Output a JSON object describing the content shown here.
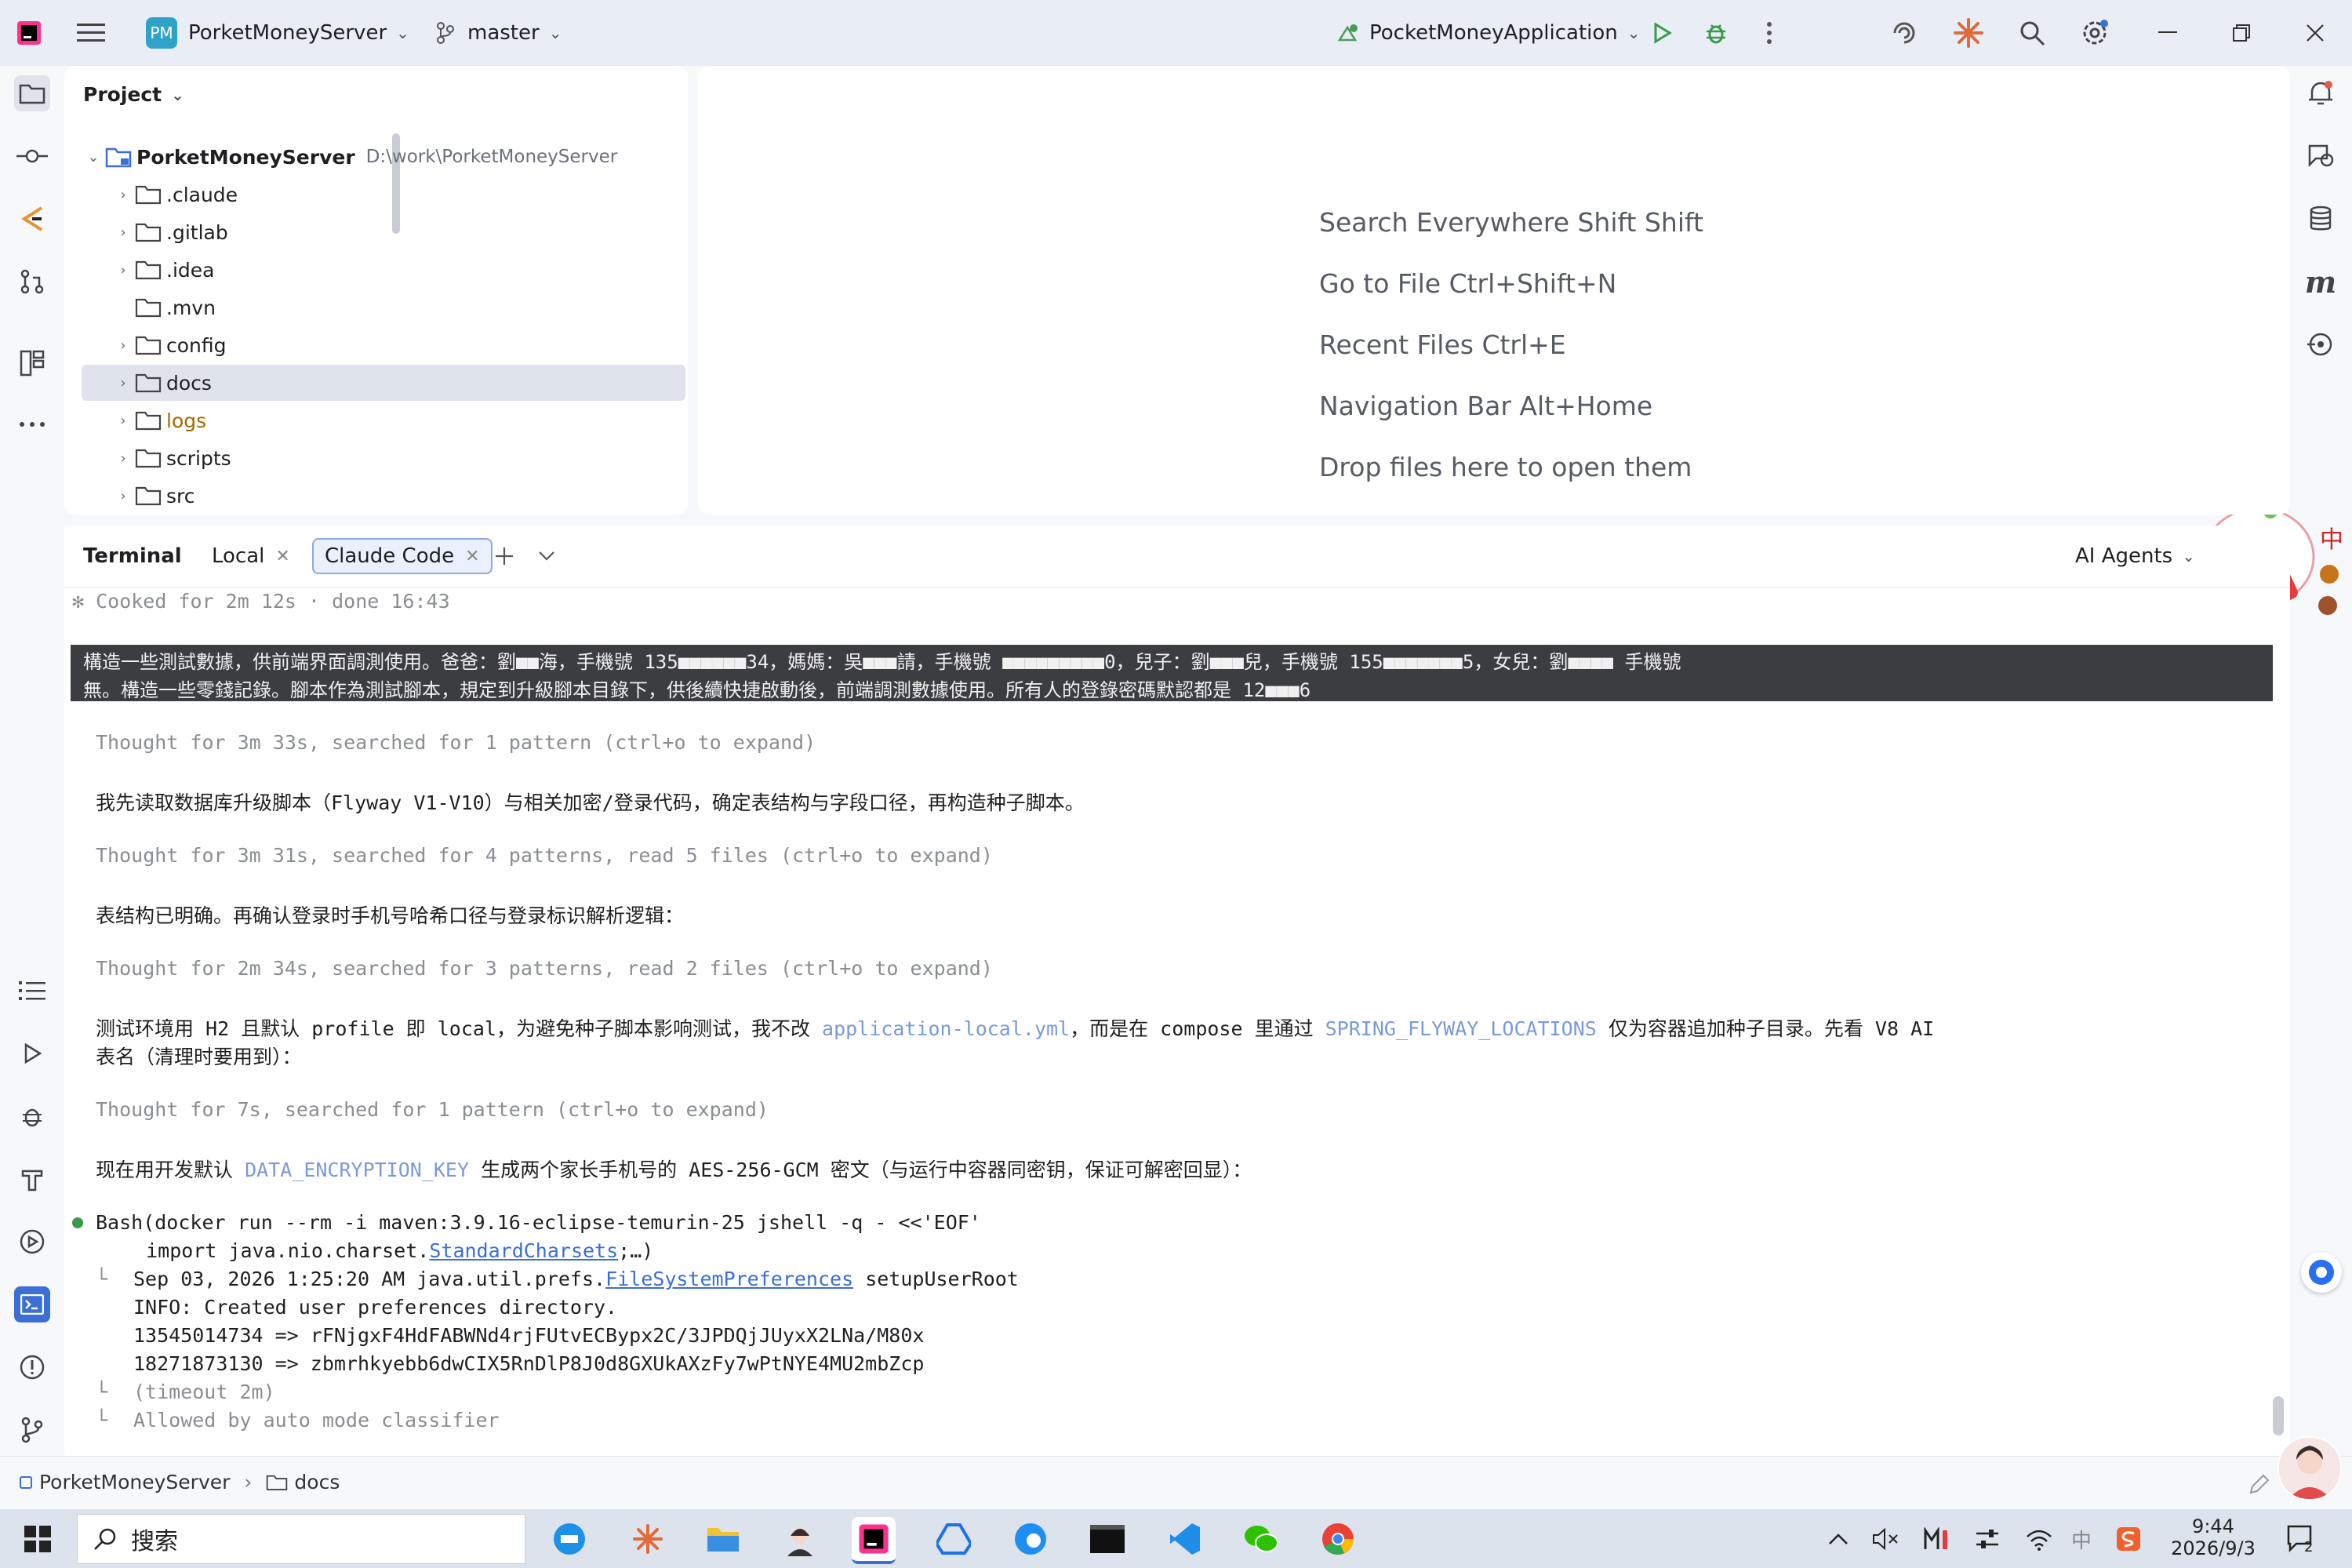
{
  "titlebar": {
    "project_badge": "PM",
    "project_name": "PorketMoneyServer",
    "branch": "master",
    "run_config": "PocketMoneyApplication",
    "icons": [
      "intellij-logo-icon",
      "hamburger-menu-icon",
      "branch-icon",
      "run-config-icon",
      "run-icon",
      "debug-icon",
      "more-vertical-icon",
      "ai-assistant-icon",
      "claude-icon",
      "search-icon",
      "settings-icon",
      "minimize-icon",
      "restore-icon",
      "close-icon"
    ]
  },
  "project_panel": {
    "title": "Project",
    "root": {
      "name": "PorketMoneyServer",
      "path": "D:\\work\\PorketMoneyServer"
    },
    "items": [
      {
        "name": ".claude"
      },
      {
        "name": ".gitlab"
      },
      {
        "name": ".idea"
      },
      {
        "name": ".mvn"
      },
      {
        "name": "config"
      },
      {
        "name": "docs"
      },
      {
        "name": "logs"
      },
      {
        "name": "scripts"
      },
      {
        "name": "src"
      }
    ]
  },
  "editor_hints": {
    "search": "Search Everywhere Shift Shift",
    "goto_file": "Go to File Ctrl+Shift+N",
    "recent": "Recent Files Ctrl+E",
    "navbar": "Navigation Bar Alt+Home",
    "drop": "Drop files here to open them"
  },
  "terminal": {
    "title": "Terminal",
    "tabs": [
      "Local",
      "Claude Code"
    ],
    "agents_label": "AI Agents",
    "lines": {
      "cooked": "✻ Cooked for 2m 12s · done 16:43",
      "prompt1": "構造一些測試數據，供前端界面調測使用。爸爸：劉■■海，手機號 135■■■■■■34，媽媽：吳■■■請，手機號 ■■■■■■■■■0，兒子：劉■■■兒，手機號 155■■■■■■■5，女兒：劉■■■■ 手機號",
      "prompt2": "無。構造一些零錢記錄。腳本作為測試腳本，規定到升級腳本目錄下，供後續快捷啟動後，前端調測數據使用。所有人的登錄密碼默認都是 12■■■6",
      "thought1": "Thought for 3m 33s, searched for 1 pattern (ctrl+o to expand)",
      "msg1": "我先读取数据库升级脚本（Flyway V1-V10）与相关加密/登录代码，确定表结构与字段口径，再构造种子脚本。",
      "thought2": "Thought for 3m 31s, searched for 4 patterns, read 5 files (ctrl+o to expand)",
      "msg2": "表结构已明确。再确认登录时手机号哈希口径与登录标识解析逻辑：",
      "thought3": "Thought for 2m 34s, searched for 3 patterns, read 2 files (ctrl+o to expand)",
      "msg3a": "测试环境用 H2 且默认 profile 即 local，为避免种子脚本影响测试，我不改 ",
      "msg3_link1": "application-local.yml",
      "msg3b": "，而是在 compose 里通过 ",
      "msg3_link2": "SPRING_FLYWAY_LOCATIONS",
      "msg3c": " 仅为容器追加种子目录。先看 V8 AI",
      "msg3d": "表名（清理时要用到）：",
      "thought4": "Thought for 7s, searched for 1 pattern (ctrl+o to expand)",
      "msg4a": "现在用开发默认 ",
      "msg4_link": "DATA_ENCRYPTION_KEY",
      "msg4b": " 生成两个家长手机号的 AES-256-GCM 密文（与运行中容器同密钥，保证可解密回显）：",
      "bash_cmd": "Bash(docker run --rm -i maven:3.9.16-eclipse-temurin-25 jshell -q - <<'EOF'",
      "bash_import_a": "  import java.nio.charset.",
      "bash_import_link": "StandardCharsets",
      "bash_import_b": ";…)",
      "out1a": "Sep 03, 2026 1:25:20 AM java.util.prefs.",
      "out1_link": "FileSystemPreferences",
      "out1b": " setupUserRoot",
      "out2": "INFO: Created user preferences directory.",
      "out3": "13545014734 => rFNjgxF4HdFABWNd4rjFUtvECBypx2C/3JPDQjJUyxX2LNa/M80x",
      "out4": "18271873130 => zbmrhkyebb6dwCIX5RnDlP8J0d8GXUkAXzFy7wPtNYE4MU2mbZcp",
      "out5": "(timeout 2m)",
      "out6": "Allowed by auto mode classifier"
    }
  },
  "statusbar": {
    "breadcrumb": [
      "PorketMoneyServer",
      "docs"
    ]
  },
  "taskbar": {
    "search_placeholder": "搜索",
    "time": "9:44",
    "date": "2026/9/3",
    "notification_count": "2"
  },
  "colors": {
    "accent": "#3b6fd6",
    "link": "#7a9ad9",
    "highlight_bg": "#3c3d40",
    "logs_folder": "#a36b00"
  }
}
